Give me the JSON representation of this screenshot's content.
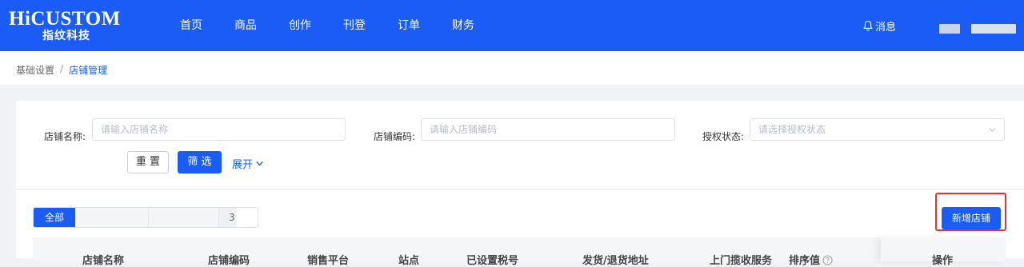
{
  "header": {
    "logo_en": "HiCUSTOM",
    "logo_cn": "指纹科技",
    "nav": [
      "首页",
      "商品",
      "创作",
      "刊登",
      "订单",
      "财务"
    ],
    "messages_label": "消息",
    "bell_icon": "bell-icon"
  },
  "breadcrumb": {
    "parent": "基础设置",
    "separator": "/",
    "current": "店铺管理"
  },
  "filters": {
    "store_name_label": "店铺名称:",
    "store_name_placeholder": "请输入店铺名称",
    "store_code_label": "店铺编码:",
    "store_code_placeholder": "请输入店铺编码",
    "auth_status_label": "授权状态:",
    "auth_status_placeholder": "请选择授权状态",
    "reset_label": "重 置",
    "filter_label": "筛 选",
    "expand_label": "展开"
  },
  "list": {
    "tabs": [
      {
        "label": "全部",
        "active": true
      },
      {
        "label": ""
      },
      {
        "label": ""
      },
      {
        "label": "3"
      }
    ],
    "add_store_label": "新增店铺",
    "columns": [
      "店铺名称",
      "店铺编码",
      "销售平台",
      "站点",
      "已设置税号",
      "发货/退货地址",
      "上门揽收服务",
      "排序值",
      "操作"
    ]
  },
  "colors": {
    "primary": "#1a5cf5",
    "highlight_border": "#e8323a"
  }
}
